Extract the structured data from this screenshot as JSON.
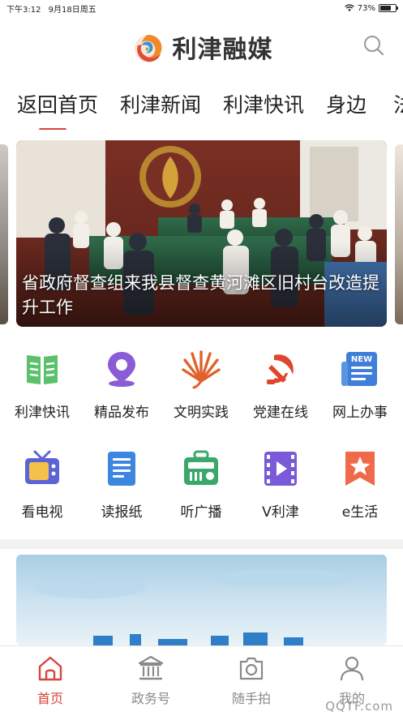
{
  "status_bar": {
    "time": "下午3:12",
    "date": "9月18日周五",
    "battery": "73%",
    "battery_level": 0.73
  },
  "header": {
    "app_name": "利津融媒",
    "search_icon": "search-icon"
  },
  "tabs": [
    {
      "label": "返回首页",
      "active": true
    },
    {
      "label": "利津新闻",
      "active": false
    },
    {
      "label": "利津快讯",
      "active": false
    },
    {
      "label": "身边",
      "active": false
    },
    {
      "label": "法",
      "active": false
    }
  ],
  "banner": {
    "title": "省政府督查组来我县督查黄河滩区旧村台改造提升工作"
  },
  "grid": [
    {
      "label": "利津快讯",
      "icon": "book-icon",
      "color": "#5bc16b"
    },
    {
      "label": "精品发布",
      "icon": "location-pin-icon",
      "color": "#8a5cd6"
    },
    {
      "label": "文明实践",
      "icon": "fan-icon",
      "color": "#e0622a"
    },
    {
      "label": "党建在线",
      "icon": "party-emblem-icon",
      "color": "#e0452d"
    },
    {
      "label": "网上办事",
      "icon": "news-icon",
      "color": "#3f7fd9"
    },
    {
      "label": "看电视",
      "icon": "tv-icon",
      "color": "#5b63d6"
    },
    {
      "label": "读报纸",
      "icon": "newspaper-icon",
      "color": "#3d86e0"
    },
    {
      "label": "听广播",
      "icon": "radio-icon",
      "color": "#3aa86b"
    },
    {
      "label": "V利津",
      "icon": "video-icon",
      "color": "#7a5ad8"
    },
    {
      "label": "e生活",
      "icon": "star-bookmark-icon",
      "color": "#ee6a4a"
    }
  ],
  "bottom_nav": [
    {
      "label": "首页",
      "icon": "home-icon",
      "active": true
    },
    {
      "label": "政务号",
      "icon": "government-building-icon",
      "active": false
    },
    {
      "label": "随手拍",
      "icon": "camera-icon",
      "active": false
    },
    {
      "label": "我的",
      "icon": "user-icon",
      "active": false
    }
  ],
  "watermark": "QQTF.com",
  "colors": {
    "accent": "#d6453e",
    "nav_inactive": "#8a8a8a"
  }
}
